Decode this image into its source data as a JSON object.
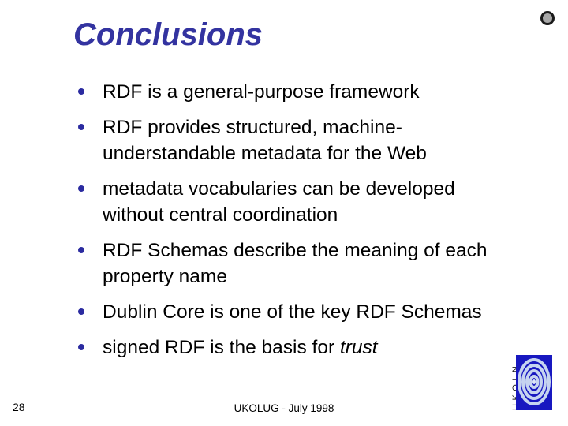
{
  "slide": {
    "title": "Conclusions",
    "title_color": "#3333a0",
    "bullet_color": "#2b2ba0",
    "text_color": "#000000",
    "background": "#ffffff",
    "bullets": [
      {
        "text": "RDF is a general-purpose framework",
        "emphasis": ""
      },
      {
        "text": "RDF provides structured, machine-understandable metadata for the Web",
        "emphasis": ""
      },
      {
        "text": "metadata vocabularies can be developed without central coordination",
        "emphasis": ""
      },
      {
        "text": "RDF Schemas describe the meaning of each property name",
        "emphasis": ""
      },
      {
        "text": "Dublin Core is one of the key RDF Schemas",
        "emphasis": ""
      },
      {
        "text": "signed RDF is the basis for ",
        "emphasis": "trust"
      }
    ]
  },
  "footer": {
    "slide_number": "28",
    "center_text": "UKOLUG - July 1998"
  },
  "logo": {
    "wordmark": "UKOLN",
    "mark_background": "#1818c0",
    "ring_color": "#b9c9ec"
  },
  "decor": {
    "corner_circle_fill": "#a8a8a8",
    "corner_circle_ring": "#1a1a1a"
  }
}
